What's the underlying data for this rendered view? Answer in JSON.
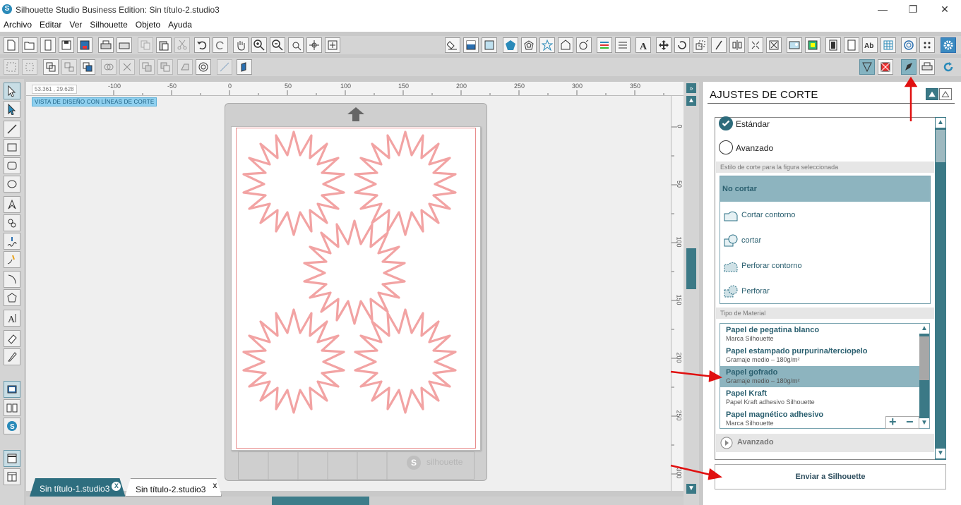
{
  "window": {
    "title": "Silhouette Studio Business Edition: Sin título-2.studio3",
    "logo": "S"
  },
  "menu": [
    "Archivo",
    "Editar",
    "Ver",
    "Silhouette",
    "Objeto",
    "Ayuda"
  ],
  "workspace": {
    "coordinates": "53.361 , 29.628",
    "view_badge": "VISTA DE DISEÑO CON LÍNEAS DE CORTE",
    "hruler_ticks": [
      "-100",
      "-50",
      "0",
      "50",
      "100",
      "150",
      "200",
      "250",
      "300",
      "350"
    ],
    "vruler_ticks": [
      "0",
      "50",
      "100",
      "150",
      "200",
      "250",
      "300"
    ],
    "watermark": "silhouette",
    "shape_color": "#f2a3a3"
  },
  "tabs": [
    {
      "label": "Sin título-1.studio3",
      "close": "X"
    },
    {
      "label": "Sin título-2.studio3",
      "close": "X"
    }
  ],
  "panel": {
    "title": "AJUSTES DE CORTE",
    "modes": [
      {
        "label": "Estándar",
        "selected": true
      },
      {
        "label": "Avanzado",
        "selected": false
      }
    ],
    "cut_style_header": "Estilo de corte para la figura seleccionada",
    "cut_styles": [
      {
        "label": "No cortar",
        "selected": true
      },
      {
        "label": "Cortar contorno",
        "selected": false
      },
      {
        "label": "cortar",
        "selected": false
      },
      {
        "label": "Perforar contorno",
        "selected": false
      },
      {
        "label": "Perforar",
        "selected": false
      }
    ],
    "material_header": "Tipo de Material",
    "materials": [
      {
        "name": "Papel de pegatina blanco",
        "sub": "Marca Silhouette",
        "selected": false
      },
      {
        "name": "Papel estampado purpurina/terciopelo",
        "sub": "Gramaje medio – 180g/m²",
        "selected": false
      },
      {
        "name": "Papel gofrado",
        "sub": "Gramaje medio – 180g/m²",
        "selected": true
      },
      {
        "name": "Papel Kraft",
        "sub": "Papel Kraft adhesivo Silhouette",
        "selected": false
      },
      {
        "name": "Papel magnético adhesivo",
        "sub": "Marca Silhouette",
        "selected": false
      }
    ],
    "advanced_label": "Avanzado",
    "send_button": "Enviar a Silhouette"
  },
  "colors": {
    "accent": "#3b7986",
    "selection": "#8db4bf",
    "annotation_arrow": "#e01010"
  }
}
